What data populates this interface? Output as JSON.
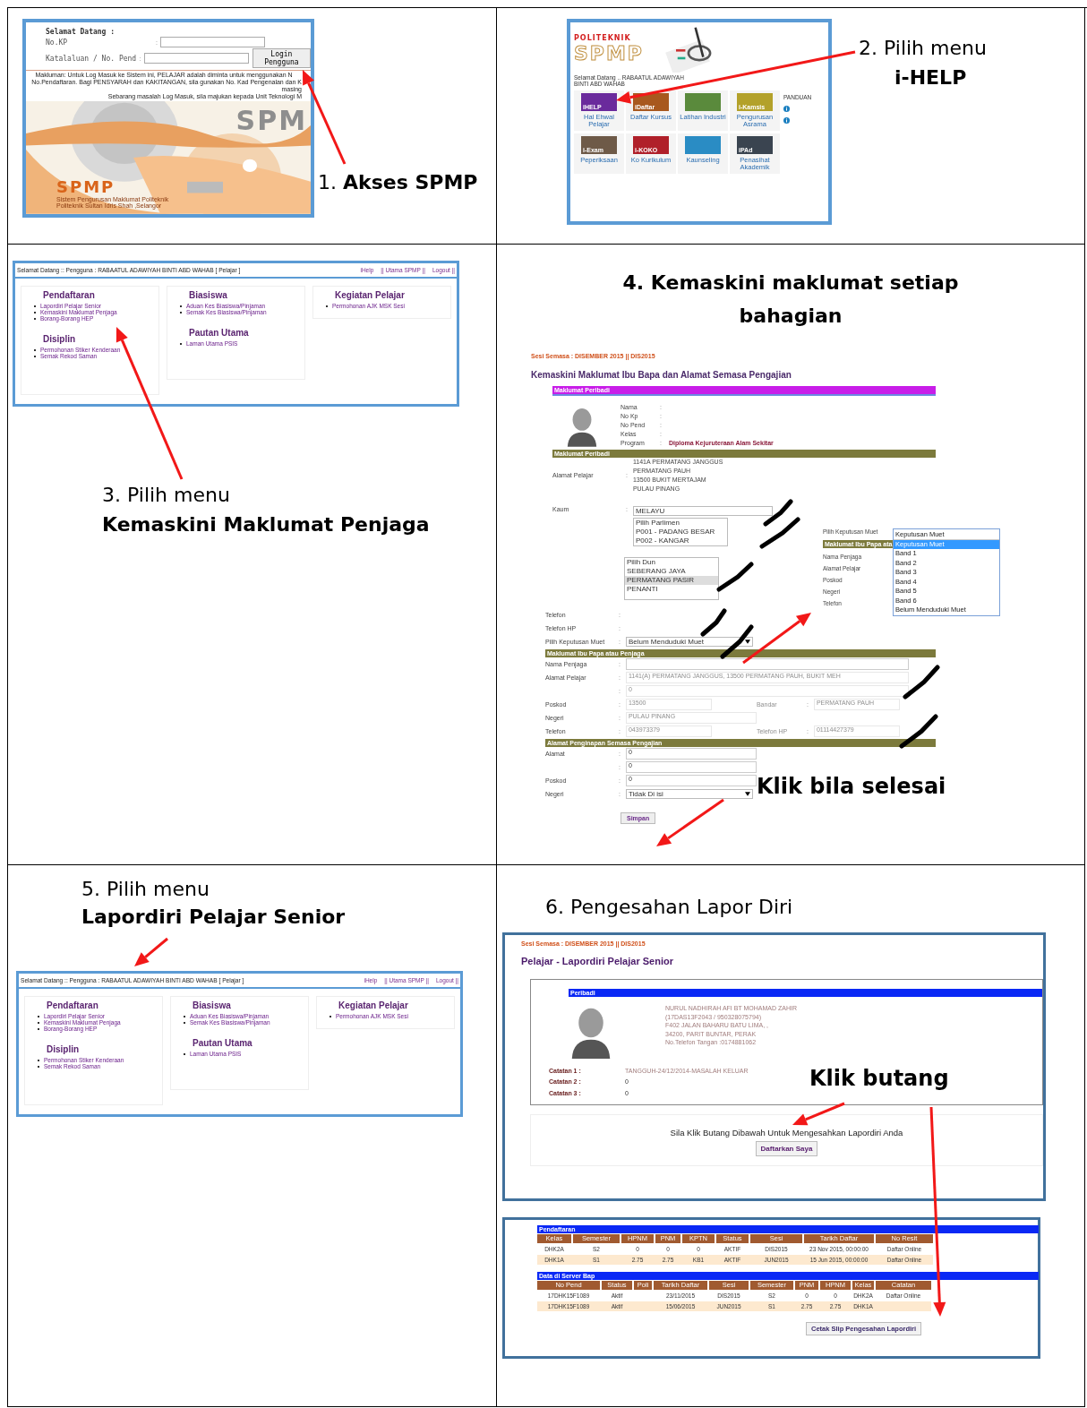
{
  "steps": [
    {
      "kind": "login",
      "caption": {
        "text": "1.  **Akses SPMP**",
        "bold": false
      },
      "screen": {
        "separator": ":",
        "greeting": "Selamat Datang :",
        "fields": [
          {
            "label": "No.KP"
          },
          {
            "label": "Katalaluan / No. Pend"
          }
        ],
        "button": "Login Pengguna",
        "notice": [
          "Makluman: Untuk Log Masuk ke Sistem ini, PELAJAR adalah diminta untuk menggunakan N",
          "No.Pendaftaran. Bagi PENSYARAH dan KAKITANGAN, sila gunakan No. Kad Pengenalan dan K",
          "masing",
          "Sebarang masalah Log Masuk, sila majukan kepada Unit Teknologi M"
        ],
        "backdrop_logo": "SPM",
        "logo": "SPMP",
        "subtitle": [
          "Sistem Pengurusan Maklumat Politeknik",
          "Politeknik Sultan Idris Shah ,Selangor"
        ]
      }
    },
    {
      "kind": "portal",
      "caption": {
        "text": "2.  Pilih menu",
        "bold": false,
        "subtitle": "i-HELP"
      },
      "screen": {
        "brand": "POLITEKNIK",
        "logo": "SPMP",
        "greeting": "Selamat Datang .. RABAATUL ADAWIYAH BINTI ABD WAHAB",
        "side_title": "PANDUAN",
        "tiles": [
          {
            "label": "iHELP",
            "caption": "Hal Ehwal Pelajar",
            "color": "#6a2a9c"
          },
          {
            "label": "iDaftar",
            "caption": "Daftar Kursus",
            "color": "#a8581e"
          },
          {
            "caption": "Latihan Industri",
            "color": "#5a8a3c"
          },
          {
            "label": "i-Kamsis",
            "caption": "Pengurusan Asrama",
            "color": "#b3a12a"
          },
          {
            "label": "i-Exam",
            "caption": "Peperiksaan",
            "color": "#6e5a48"
          },
          {
            "label": "i-KOKO",
            "caption": "Ko Kurikulum",
            "color": "#b0202a"
          },
          {
            "caption": "Kaunseling",
            "color": "#2a8cc4"
          },
          {
            "label": "iPAd",
            "caption": "Penasihat Akademik",
            "color": "#3a4450"
          }
        ]
      }
    },
    {
      "kind": "menu",
      "caption": {
        "text": "3.  Pilih menu",
        "bold": false,
        "subtitle": "Kemaskini Maklumat Penjaga"
      },
      "screen": {
        "greeting": "Selamat Datang :: Pengguna : RABAATUL ADAWIYAH BINTI ABD WAHAB [ Pelajar ]",
        "links": [
          "iHelp",
          "|| Utama SPMP ||",
          "Logout ||"
        ],
        "columns": [
          [
            {
              "title": "Pendaftaran",
              "items": [
                "Lapordiri Pelajar Senior",
                "Kemaskini Maklumat Penjaga",
                "Borang-Borang HEP"
              ]
            },
            {
              "title": "Disiplin",
              "items": [
                "Permohonan Stiker Kenderaan",
                "Semak Rekod Saman"
              ]
            }
          ],
          [
            {
              "title": "Biasiswa",
              "items": [
                "Aduan Kes Biasiswa/Pinjaman",
                "Semak Kes Biasiswa/Pinjaman"
              ]
            },
            {
              "title": "Pautan Utama",
              "items": [
                "Laman Utama PSIS"
              ]
            }
          ],
          [
            {
              "title": "Kegiatan Pelajar",
              "items": [
                "Permohonan AJK MSK Sesi"
              ]
            }
          ]
        ]
      }
    },
    {
      "kind": "form",
      "caption": {
        "text": "4.  Kemaskini maklumat setiap bahagian",
        "bold": true
      },
      "note": "Klik bila selesai",
      "screen": {
        "separator": ":",
        "session": "Sesi Semasa : DISEMBER 2015 || DIS2015",
        "heading": "Kemaskini Maklumat Ibu Bapa dan Alamat Semasa Pengajian",
        "profile_bar": "Maklumat Peribadi",
        "profile": [
          {
            "label": "Nama"
          },
          {
            "label": "No Kp"
          },
          {
            "label": "No Pend"
          },
          {
            "label": "Kelas"
          },
          {
            "label": "Program",
            "value": "Diploma Kejuruteraan Alam Sekitar"
          }
        ],
        "address_bar": "Maklumat Peribadi",
        "address_label": "Alamat Pelajar",
        "address": [
          "1141A PERMATANG JANGGUS",
          "PERMATANG PAUH",
          "13500 BUKIT MERTAJAM",
          "PULAU PINANG"
        ],
        "race_label": "Kaum",
        "race": "MELAYU",
        "parliament": [
          "Pilih Parlimen",
          "P001 - PADANG BESAR",
          "P002 - KANGAR"
        ],
        "dun": [
          {
            "text": "Pilih Dun",
            "selected": false
          },
          {
            "text": "SEBERANG JAYA",
            "selected": false
          },
          {
            "text": "PERMATANG PASIR",
            "selected": true
          },
          {
            "text": "PENANTI",
            "selected": false
          }
        ],
        "phone_labels": [
          "Telefon",
          "Telefon HP"
        ],
        "muet_label": "Pilih Keputusan Muet",
        "muet": "Belum Menduduki Muet",
        "guardian_bar": "Maklumat Ibu Papa atau Penjaga",
        "guardian": [
          {
            "label": "Nama Penjaga",
            "values": [
              {
                "disabled": false
              }
            ]
          },
          {
            "label": "Alamat Pelajar",
            "values": [
              {
                "text": "1141(A) PERMATANG JANGGUS, 13500 PERMATANG PAUH, BUKIT MEH",
                "disabled": true
              }
            ]
          },
          {
            "values": [
              {
                "text": "0",
                "disabled": true
              }
            ]
          },
          {
            "label": "Poskod",
            "values": [
              {
                "text": "13500",
                "disabled": true
              }
            ],
            "label2": "Bandar",
            "values2": [
              {
                "text": "PERMATANG PAUH",
                "disabled": true
              }
            ]
          },
          {
            "label": "Negeri",
            "values": [
              {
                "text": "PULAU PINANG",
                "disabled": true,
                "kind": "select"
              }
            ]
          },
          {
            "label": "Telefon",
            "values": [
              {
                "text": "043973379",
                "disabled": true
              }
            ],
            "label2": "Telefon HP",
            "values2": [
              {
                "text": "01114427379",
                "disabled": true
              }
            ]
          }
        ],
        "lodging_bar": "Alamat Penginapan Semasa Pengajian",
        "lodging": [
          {
            "label": "Alamat",
            "value": "0",
            "kind": "input"
          },
          {
            "value": "0",
            "kind": "input"
          },
          {
            "label": "Poskod",
            "value": "0",
            "kind": "input"
          },
          {
            "label": "Negeri",
            "value": "Tidak Di isi",
            "kind": "select"
          }
        ],
        "button": "Simpan",
        "popup": {
          "label": "Pilih Keputusan Muet",
          "bar": "Maklumat Ibu Papa ata",
          "labels": [
            "Nama Penjaga",
            "Alamat Pelajar",
            "Poskod",
            "Negeri",
            "Telefon"
          ],
          "field": "Keputusan Muet",
          "options": [
            {
              "text": "Keputusan Muet",
              "selected": true
            },
            {
              "text": "Band 1",
              "selected": false
            },
            {
              "text": "Band 2",
              "selected": false
            },
            {
              "text": "Band 3",
              "selected": false
            },
            {
              "text": "Band 4",
              "selected": false
            },
            {
              "text": "Band 5",
              "selected": false
            },
            {
              "text": "Band 6",
              "selected": false
            },
            {
              "text": "Belum Menduduki Muet",
              "selected": false
            }
          ]
        }
      }
    },
    {
      "kind": "menu",
      "caption": {
        "text": "5.  Pilih menu",
        "bold": false,
        "subtitle": "Lapordiri Pelajar Senior"
      },
      "screen": {
        "greeting": "Selamat Datang :: Pengguna : RABAATUL ADAWIYAH BINTI ABD WAHAB [ Pelajar ]",
        "links": [
          "iHelp",
          "|| Utama SPMP ||",
          "Logout ||"
        ],
        "columns": [
          [
            {
              "title": "Pendaftaran",
              "items": [
                "Lapordiri Pelajar Senior",
                "Kemaskini Maklumat Penjaga",
                "Borang-Borang HEP"
              ]
            },
            {
              "title": "Disiplin",
              "items": [
                "Permohonan Stiker Kenderaan",
                "Semak Rekod Saman"
              ]
            }
          ],
          [
            {
              "title": "Biasiswa",
              "items": [
                "Aduan Kes Biasiswa/Pinjaman",
                "Semak Kes Biasiswa/Pinjaman"
              ]
            },
            {
              "title": "Pautan Utama",
              "items": [
                "Laman Utama PSIS"
              ]
            }
          ],
          [
            {
              "title": "Kegiatan Pelajar",
              "items": [
                "Permohonan AJK MSK Sesi"
              ]
            }
          ]
        ]
      }
    },
    {
      "kind": "confirm",
      "caption": {
        "text": "6.  Pengesahan Lapor Diri",
        "bold": false
      },
      "note": "Klik butang",
      "screen": {
        "session": "Sesi Semasa : DISEMBER 2015 || DIS2015",
        "heading": "Pelajar - Lapordiri Pelajar Senior",
        "bar": "Peribadi",
        "details": [
          "NURUL NADHIRAH AFI BT MOHAMAD ZAHIR",
          "(17DAS13F2043 / 950328075794)",
          "F402 JALAN BAHARU BATU LIMA, ,",
          "34200, PARIT BUNTAR, PERAK",
          "No.Telefon Tangan :0174881062"
        ],
        "notes": [
          {
            "label": "Catatan 1 :",
            "value": "TANGGUH-24/12/2014-MASALAH KELUAR"
          },
          {
            "label": "Catatan 2 :",
            "value": "0"
          },
          {
            "label": "Catatan 3 :",
            "value": "0"
          }
        ],
        "prompt": "Sila Klik Butang Dibawah Untuk Mengesahkan Lapordiri Anda",
        "button": "Daftarkan Saya",
        "tables": [
          {
            "title": "Pendaftaran",
            "columns": [
              "Kelas",
              "Semester",
              "HPNM",
              "PNM",
              "KPTN",
              "Status",
              "Sesi",
              "Tarikh Daftar",
              "No Resit"
            ],
            "rows": [
              [
                "DHK2A",
                "S2",
                "0",
                "0",
                "0",
                "AKTIF",
                "DIS2015",
                "23 Nov 2015, 00:00:00",
                "Daftar Online"
              ],
              [
                "DHK1A",
                "S1",
                "2.75",
                "2.75",
                "KB1",
                "AKTIF",
                "JUN2015",
                "15 Jun 2015, 00:00:00",
                "Daftar Online"
              ]
            ]
          },
          {
            "title": "Data di Server Bap",
            "columns": [
              "No Pend",
              "Status",
              "Poli",
              "Tarikh Daftar",
              "Sesi",
              "Semester",
              "PNM",
              "HPNM",
              "Kelas",
              "Catatan"
            ],
            "rows": [
              [
                "17DHK15F1089",
                "Aktif",
                null,
                "23/11/2015",
                "DIS2015",
                "S2",
                "0",
                "0",
                "DHK2A",
                "Daftar Online"
              ],
              [
                "17DHK15F1089",
                "Aktif",
                null,
                "15/06/2015",
                "JUN2015",
                "S1",
                "2.75",
                "2.75",
                "DHK1A",
                null
              ]
            ]
          }
        ],
        "print_button": "Cetak Slip Pengesahan Lapordiri"
      }
    }
  ]
}
